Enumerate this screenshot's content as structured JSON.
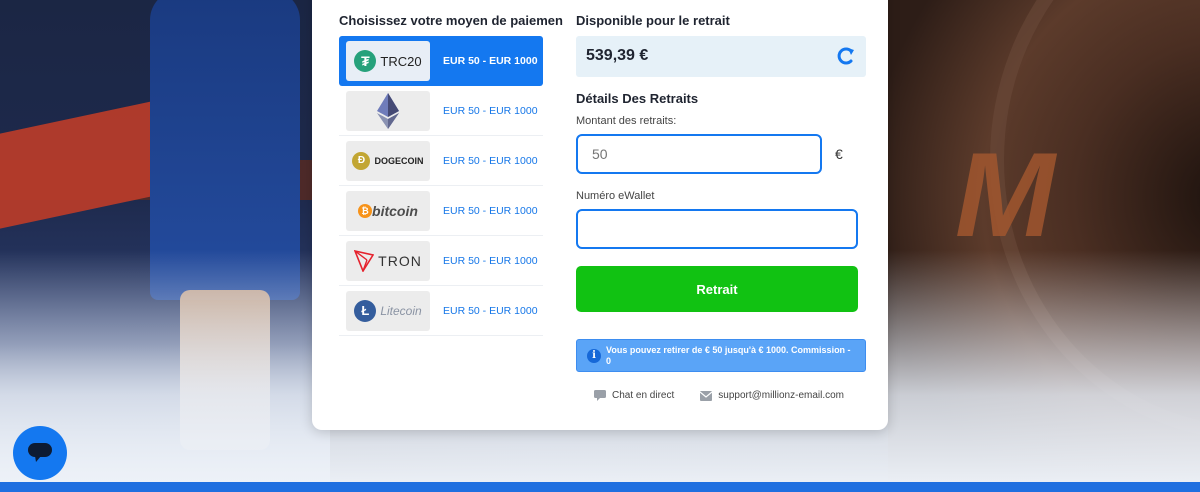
{
  "left_panel": {
    "title": "Choisissez votre moyen de paiemen",
    "methods": [
      {
        "name": "TRC20",
        "logo": "trc20-logo",
        "range": "EUR 50 - EUR 1000",
        "active": true
      },
      {
        "name": "",
        "logo": "ethereum-logo",
        "range": "EUR 50 - EUR 1000",
        "active": false
      },
      {
        "name": "DOGECOIN",
        "logo": "dogecoin-logo",
        "range": "EUR 50 - EUR 1000",
        "active": false
      },
      {
        "name": "bitcoin",
        "logo": "bitcoin-logo",
        "range": "EUR 50 - EUR 1000",
        "active": false
      },
      {
        "name": "TRON",
        "logo": "tron-logo",
        "range": "EUR 50 - EUR 1000",
        "active": false
      },
      {
        "name": "Litecoin",
        "logo": "litecoin-logo",
        "range": "EUR 50 - EUR 1000",
        "active": false
      }
    ]
  },
  "right_panel": {
    "available_title": "Disponible pour le retrait",
    "balance": "539,39 €",
    "details_title": "Détails Des Retraits",
    "amount_label": "Montant des retraits:",
    "amount_placeholder": "50",
    "currency": "€",
    "wallet_label": "Numéro eWallet",
    "wallet_value": "",
    "submit_label": "Retrait",
    "info_text": "Vous pouvez retirer de € 50 jusqu'à € 1000. Commission - 0",
    "live_chat": "Chat en direct",
    "support_email": "support@millionz-email.com"
  },
  "colors": {
    "accent": "#1478f0",
    "submit": "#11c212",
    "info": "#5aa4f7"
  }
}
